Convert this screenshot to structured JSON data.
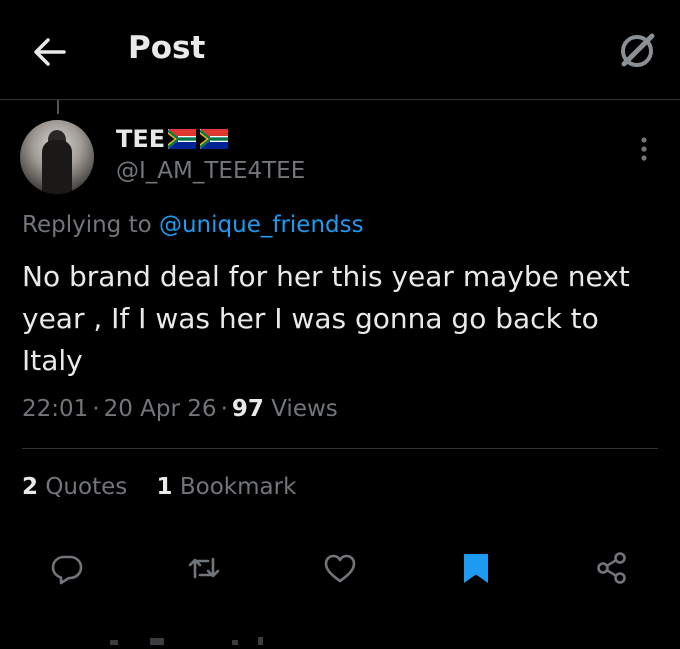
{
  "header": {
    "title": "Post"
  },
  "tweet": {
    "display_name": "TEE",
    "flag_icons": [
      "south-africa-flag",
      "south-africa-flag"
    ],
    "handle": "@I_AM_TEE4TEE",
    "replying_prefix": "Replying to",
    "replying_to": "@unique_friendss",
    "text": "No brand deal for her this year maybe next year , If  I was her I was gonna go back to Italy",
    "time": "22:01",
    "date": "20 Apr 26",
    "separator": "·",
    "views_count": "97",
    "views_label": "Views"
  },
  "engagement": {
    "quotes_count": "2",
    "quotes_label": "Quotes",
    "bookmarks_count": "1",
    "bookmarks_label": "Bookmark"
  },
  "actions": [
    "reply-icon",
    "retweet-icon",
    "like-icon",
    "bookmark-icon",
    "share-icon"
  ],
  "colors": {
    "background": "#000000",
    "text": "#e7e9ea",
    "secondary": "#71767b",
    "accent": "#1d9bf0",
    "divider": "#2f3336"
  }
}
